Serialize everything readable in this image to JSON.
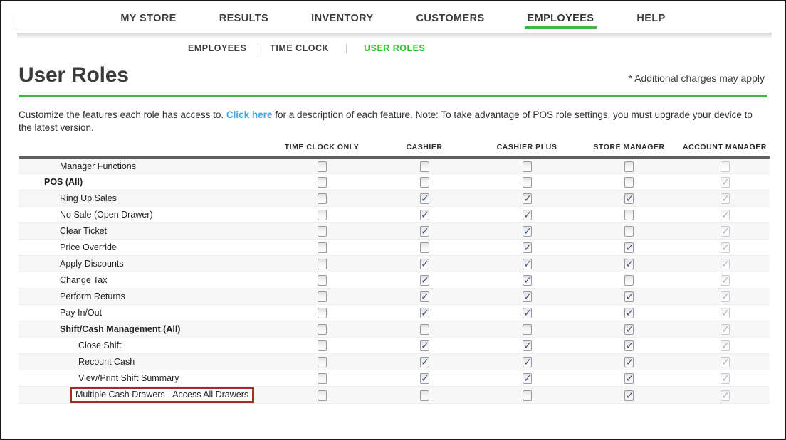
{
  "topnav": {
    "items": [
      {
        "label": "MY STORE",
        "active": false
      },
      {
        "label": "RESULTS",
        "active": false
      },
      {
        "label": "INVENTORY",
        "active": false
      },
      {
        "label": "CUSTOMERS",
        "active": false
      },
      {
        "label": "EMPLOYEES",
        "active": true
      },
      {
        "label": "HELP",
        "active": false
      }
    ],
    "active_underline_color": "#3fb93f"
  },
  "subnav": {
    "items": [
      {
        "label": "EMPLOYEES",
        "active": false
      },
      {
        "label": "TIME CLOCK",
        "active": false
      },
      {
        "label": "USER ROLES",
        "active": true
      }
    ],
    "active_color": "#2fc02f"
  },
  "page": {
    "title": "User Roles",
    "note": "* Additional charges may apply",
    "rule_color": "#3fb93f",
    "intro_before_link": "Customize the features each role has access to. ",
    "intro_link": "Click here",
    "intro_after_link": " for a description of each feature. Note: To take advantage of POS role settings, you must upgrade your device to the latest version.",
    "link_color": "#4aa3df"
  },
  "table": {
    "feature_column_header": "",
    "columns": [
      "TIME CLOCK ONLY",
      "CASHIER",
      "CASHIER PLUS",
      "STORE MANAGER",
      "ACCOUNT MANAGER"
    ],
    "highlight_color": "#a92b1f",
    "rows": [
      {
        "label": "Manager Functions",
        "level": 2,
        "bold": false,
        "highlighted": false,
        "checks": [
          false,
          false,
          false,
          false,
          false
        ],
        "dimmed": [
          false,
          false,
          false,
          false,
          true
        ]
      },
      {
        "label": "POS (All)",
        "level": 1,
        "bold": true,
        "highlighted": false,
        "checks": [
          false,
          false,
          false,
          false,
          true
        ],
        "dimmed": [
          false,
          false,
          false,
          false,
          true
        ]
      },
      {
        "label": "Ring Up Sales",
        "level": 2,
        "bold": false,
        "highlighted": false,
        "checks": [
          false,
          true,
          true,
          true,
          true
        ],
        "dimmed": [
          false,
          false,
          false,
          false,
          true
        ]
      },
      {
        "label": "No Sale (Open Drawer)",
        "level": 2,
        "bold": false,
        "highlighted": false,
        "checks": [
          false,
          true,
          true,
          false,
          true
        ],
        "dimmed": [
          false,
          false,
          false,
          false,
          true
        ]
      },
      {
        "label": "Clear Ticket",
        "level": 2,
        "bold": false,
        "highlighted": false,
        "checks": [
          false,
          true,
          true,
          false,
          true
        ],
        "dimmed": [
          false,
          false,
          false,
          false,
          true
        ]
      },
      {
        "label": "Price Override",
        "level": 2,
        "bold": false,
        "highlighted": false,
        "checks": [
          false,
          false,
          true,
          true,
          true
        ],
        "dimmed": [
          false,
          false,
          false,
          false,
          true
        ]
      },
      {
        "label": "Apply Discounts",
        "level": 2,
        "bold": false,
        "highlighted": false,
        "checks": [
          false,
          true,
          true,
          true,
          true
        ],
        "dimmed": [
          false,
          false,
          false,
          false,
          true
        ]
      },
      {
        "label": "Change Tax",
        "level": 2,
        "bold": false,
        "highlighted": false,
        "checks": [
          false,
          true,
          true,
          false,
          true
        ],
        "dimmed": [
          false,
          false,
          false,
          false,
          true
        ]
      },
      {
        "label": "Perform Returns",
        "level": 2,
        "bold": false,
        "highlighted": false,
        "checks": [
          false,
          true,
          true,
          true,
          true
        ],
        "dimmed": [
          false,
          false,
          false,
          false,
          true
        ]
      },
      {
        "label": "Pay In/Out",
        "level": 2,
        "bold": false,
        "highlighted": false,
        "checks": [
          false,
          true,
          true,
          true,
          true
        ],
        "dimmed": [
          false,
          false,
          false,
          false,
          true
        ]
      },
      {
        "label": "Shift/Cash Management (All)",
        "level": 2,
        "bold": true,
        "highlighted": false,
        "checks": [
          false,
          false,
          false,
          true,
          true
        ],
        "dimmed": [
          false,
          false,
          false,
          false,
          true
        ]
      },
      {
        "label": "Close Shift",
        "level": 3,
        "bold": false,
        "highlighted": false,
        "checks": [
          false,
          true,
          true,
          true,
          true
        ],
        "dimmed": [
          false,
          false,
          false,
          false,
          true
        ]
      },
      {
        "label": "Recount Cash",
        "level": 3,
        "bold": false,
        "highlighted": false,
        "checks": [
          false,
          true,
          true,
          true,
          true
        ],
        "dimmed": [
          false,
          false,
          false,
          false,
          true
        ]
      },
      {
        "label": "View/Print Shift Summary",
        "level": 3,
        "bold": false,
        "highlighted": false,
        "checks": [
          false,
          true,
          true,
          true,
          true
        ],
        "dimmed": [
          false,
          false,
          false,
          false,
          true
        ]
      },
      {
        "label": "Multiple Cash Drawers - Access All Drawers",
        "level": 3,
        "bold": false,
        "highlighted": true,
        "checks": [
          false,
          false,
          false,
          true,
          true
        ],
        "dimmed": [
          false,
          false,
          false,
          false,
          true
        ]
      }
    ]
  },
  "icons": {
    "checkmark": "✓"
  }
}
